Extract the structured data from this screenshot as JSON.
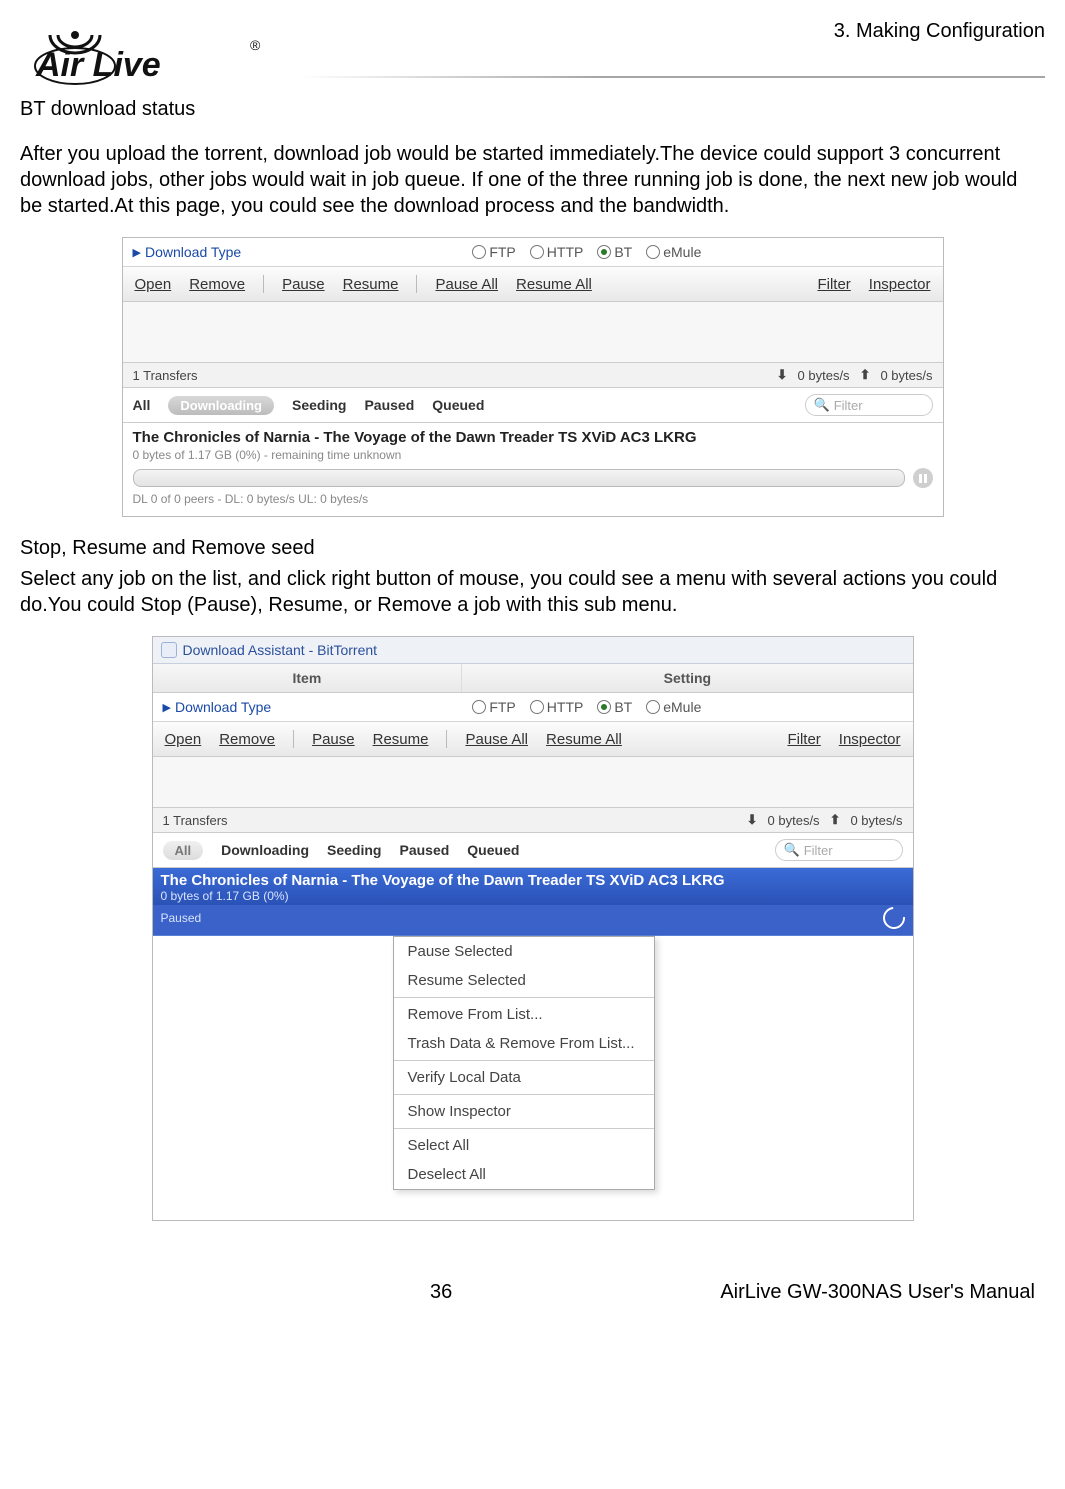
{
  "header": {
    "chapter": "3. Making Configuration"
  },
  "logo": {
    "brand": "Air Live",
    "registered": "®"
  },
  "section1": {
    "title": "BT download status",
    "para": "After you upload the torrent, download job would be started immediately.The device could support 3 concurrent download jobs, other jobs would wait in job queue. If one of the three running job is done, the next new job would be started.At this page, you could see the download process and the bandwidth."
  },
  "panel1": {
    "download_type_label": "Download Type",
    "radios": {
      "ftp": "FTP",
      "http": "HTTP",
      "bt": "BT",
      "emule": "eMule"
    },
    "toolbar": {
      "open": "Open",
      "remove": "Remove",
      "pause": "Pause",
      "resume": "Resume",
      "pause_all": "Pause All",
      "resume_all": "Resume All",
      "filter": "Filter",
      "inspector": "Inspector"
    },
    "status": {
      "transfers": "1 Transfers",
      "down": "0 bytes/s",
      "up": "0 bytes/s"
    },
    "tabs": {
      "all": "All",
      "downloading": "Downloading",
      "seeding": "Seeding",
      "paused": "Paused",
      "queued": "Queued",
      "filter_placeholder": "Filter"
    },
    "torrent": {
      "title": "The Chronicles of Narnia - The Voyage of the Dawn Treader TS XViD AC3 LKRG",
      "sub": "0 bytes of 1.17 GB (0%) - remaining time unknown",
      "peers": "DL 0 of 0 peers - DL: 0 bytes/s UL: 0 bytes/s"
    }
  },
  "section2": {
    "title": "Stop, Resume and Remove seed",
    "para": "Select any job on the list, and click right button of mouse, you could see a menu with several actions you could do.You could Stop (Pause), Resume, or Remove a job with this sub menu."
  },
  "panel2": {
    "window_title": "Download Assistant - BitTorrent",
    "cols": {
      "item": "Item",
      "setting": "Setting"
    },
    "download_type_label": "Download Type",
    "radios": {
      "ftp": "FTP",
      "http": "HTTP",
      "bt": "BT",
      "emule": "eMule"
    },
    "toolbar": {
      "open": "Open",
      "remove": "Remove",
      "pause": "Pause",
      "resume": "Resume",
      "pause_all": "Pause All",
      "resume_all": "Resume All",
      "filter": "Filter",
      "inspector": "Inspector"
    },
    "status": {
      "transfers": "1 Transfers",
      "down": "0 bytes/s",
      "up": "0 bytes/s"
    },
    "tabs": {
      "all": "All",
      "downloading": "Downloading",
      "seeding": "Seeding",
      "paused": "Paused",
      "queued": "Queued",
      "filter_placeholder": "Filter"
    },
    "selected": {
      "title": "The Chronicles of Narnia - The Voyage of the Dawn Treader TS XViD AC3 LKRG",
      "sub": "0 bytes of 1.17 GB (0%)",
      "state": "Paused"
    },
    "menu": {
      "pause_sel": "Pause Selected",
      "resume_sel": "Resume Selected",
      "remove_list": "Remove From List...",
      "trash": "Trash Data & Remove From List...",
      "verify": "Verify Local Data",
      "show_insp": "Show Inspector",
      "select_all": "Select All",
      "deselect_all": "Deselect All"
    }
  },
  "footer": {
    "page": "36",
    "manual": "AirLive GW-300NAS User's Manual"
  }
}
